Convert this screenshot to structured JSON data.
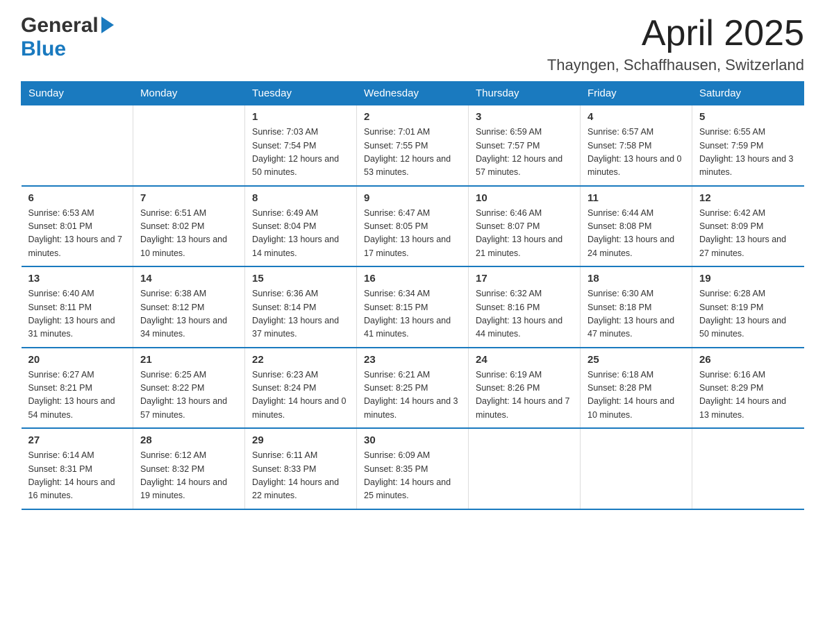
{
  "header": {
    "month_year": "April 2025",
    "location": "Thayngen, Schaffhausen, Switzerland",
    "logo_general": "General",
    "logo_blue": "Blue"
  },
  "days_of_week": [
    "Sunday",
    "Monday",
    "Tuesday",
    "Wednesday",
    "Thursday",
    "Friday",
    "Saturday"
  ],
  "weeks": [
    [
      {
        "day": "",
        "info": ""
      },
      {
        "day": "",
        "info": ""
      },
      {
        "day": "1",
        "info": "Sunrise: 7:03 AM\nSunset: 7:54 PM\nDaylight: 12 hours\nand 50 minutes."
      },
      {
        "day": "2",
        "info": "Sunrise: 7:01 AM\nSunset: 7:55 PM\nDaylight: 12 hours\nand 53 minutes."
      },
      {
        "day": "3",
        "info": "Sunrise: 6:59 AM\nSunset: 7:57 PM\nDaylight: 12 hours\nand 57 minutes."
      },
      {
        "day": "4",
        "info": "Sunrise: 6:57 AM\nSunset: 7:58 PM\nDaylight: 13 hours\nand 0 minutes."
      },
      {
        "day": "5",
        "info": "Sunrise: 6:55 AM\nSunset: 7:59 PM\nDaylight: 13 hours\nand 3 minutes."
      }
    ],
    [
      {
        "day": "6",
        "info": "Sunrise: 6:53 AM\nSunset: 8:01 PM\nDaylight: 13 hours\nand 7 minutes."
      },
      {
        "day": "7",
        "info": "Sunrise: 6:51 AM\nSunset: 8:02 PM\nDaylight: 13 hours\nand 10 minutes."
      },
      {
        "day": "8",
        "info": "Sunrise: 6:49 AM\nSunset: 8:04 PM\nDaylight: 13 hours\nand 14 minutes."
      },
      {
        "day": "9",
        "info": "Sunrise: 6:47 AM\nSunset: 8:05 PM\nDaylight: 13 hours\nand 17 minutes."
      },
      {
        "day": "10",
        "info": "Sunrise: 6:46 AM\nSunset: 8:07 PM\nDaylight: 13 hours\nand 21 minutes."
      },
      {
        "day": "11",
        "info": "Sunrise: 6:44 AM\nSunset: 8:08 PM\nDaylight: 13 hours\nand 24 minutes."
      },
      {
        "day": "12",
        "info": "Sunrise: 6:42 AM\nSunset: 8:09 PM\nDaylight: 13 hours\nand 27 minutes."
      }
    ],
    [
      {
        "day": "13",
        "info": "Sunrise: 6:40 AM\nSunset: 8:11 PM\nDaylight: 13 hours\nand 31 minutes."
      },
      {
        "day": "14",
        "info": "Sunrise: 6:38 AM\nSunset: 8:12 PM\nDaylight: 13 hours\nand 34 minutes."
      },
      {
        "day": "15",
        "info": "Sunrise: 6:36 AM\nSunset: 8:14 PM\nDaylight: 13 hours\nand 37 minutes."
      },
      {
        "day": "16",
        "info": "Sunrise: 6:34 AM\nSunset: 8:15 PM\nDaylight: 13 hours\nand 41 minutes."
      },
      {
        "day": "17",
        "info": "Sunrise: 6:32 AM\nSunset: 8:16 PM\nDaylight: 13 hours\nand 44 minutes."
      },
      {
        "day": "18",
        "info": "Sunrise: 6:30 AM\nSunset: 8:18 PM\nDaylight: 13 hours\nand 47 minutes."
      },
      {
        "day": "19",
        "info": "Sunrise: 6:28 AM\nSunset: 8:19 PM\nDaylight: 13 hours\nand 50 minutes."
      }
    ],
    [
      {
        "day": "20",
        "info": "Sunrise: 6:27 AM\nSunset: 8:21 PM\nDaylight: 13 hours\nand 54 minutes."
      },
      {
        "day": "21",
        "info": "Sunrise: 6:25 AM\nSunset: 8:22 PM\nDaylight: 13 hours\nand 57 minutes."
      },
      {
        "day": "22",
        "info": "Sunrise: 6:23 AM\nSunset: 8:24 PM\nDaylight: 14 hours\nand 0 minutes."
      },
      {
        "day": "23",
        "info": "Sunrise: 6:21 AM\nSunset: 8:25 PM\nDaylight: 14 hours\nand 3 minutes."
      },
      {
        "day": "24",
        "info": "Sunrise: 6:19 AM\nSunset: 8:26 PM\nDaylight: 14 hours\nand 7 minutes."
      },
      {
        "day": "25",
        "info": "Sunrise: 6:18 AM\nSunset: 8:28 PM\nDaylight: 14 hours\nand 10 minutes."
      },
      {
        "day": "26",
        "info": "Sunrise: 6:16 AM\nSunset: 8:29 PM\nDaylight: 14 hours\nand 13 minutes."
      }
    ],
    [
      {
        "day": "27",
        "info": "Sunrise: 6:14 AM\nSunset: 8:31 PM\nDaylight: 14 hours\nand 16 minutes."
      },
      {
        "day": "28",
        "info": "Sunrise: 6:12 AM\nSunset: 8:32 PM\nDaylight: 14 hours\nand 19 minutes."
      },
      {
        "day": "29",
        "info": "Sunrise: 6:11 AM\nSunset: 8:33 PM\nDaylight: 14 hours\nand 22 minutes."
      },
      {
        "day": "30",
        "info": "Sunrise: 6:09 AM\nSunset: 8:35 PM\nDaylight: 14 hours\nand 25 minutes."
      },
      {
        "day": "",
        "info": ""
      },
      {
        "day": "",
        "info": ""
      },
      {
        "day": "",
        "info": ""
      }
    ]
  ]
}
